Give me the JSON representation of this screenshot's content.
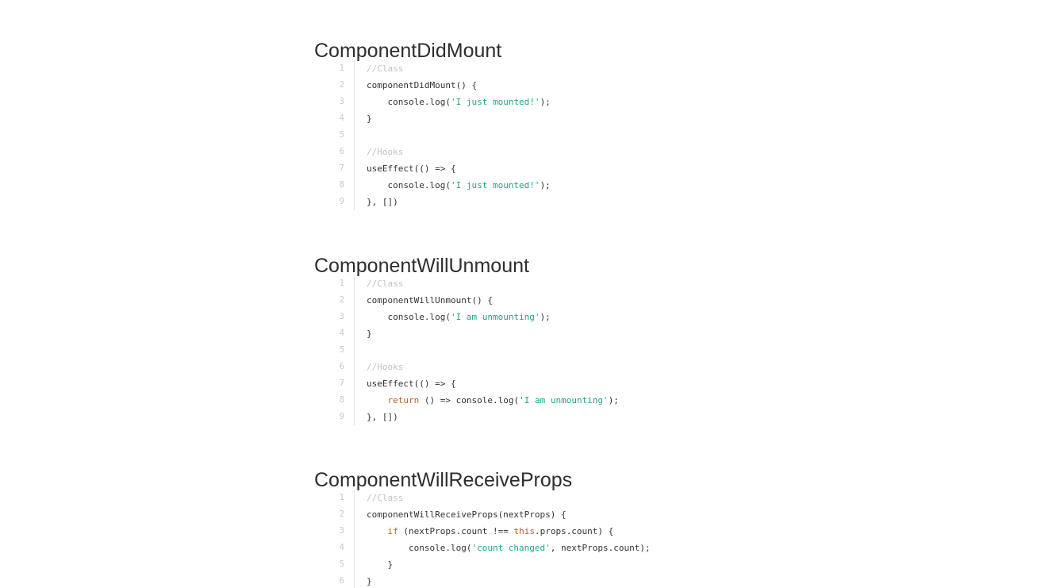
{
  "colors": {
    "comment": "#c2c2c2",
    "string": "#22a38a",
    "keyword": "#b5651d",
    "plain": "#333333",
    "line_number": "#c8c8c8"
  },
  "sections": [
    {
      "title": "ComponentDidMount",
      "lines": [
        {
          "n": "1",
          "tokens": [
            {
              "t": "comment",
              "v": "//Class"
            }
          ]
        },
        {
          "n": "2",
          "tokens": [
            {
              "t": "plain",
              "v": "componentDidMount() {"
            }
          ]
        },
        {
          "n": "3",
          "tokens": [
            {
              "t": "plain",
              "v": "    console.log("
            },
            {
              "t": "string",
              "v": "'I just mounted!'"
            },
            {
              "t": "plain",
              "v": ");"
            }
          ]
        },
        {
          "n": "4",
          "tokens": [
            {
              "t": "plain",
              "v": "}"
            }
          ]
        },
        {
          "n": "5",
          "tokens": []
        },
        {
          "n": "6",
          "tokens": [
            {
              "t": "comment",
              "v": "//Hooks"
            }
          ]
        },
        {
          "n": "7",
          "tokens": [
            {
              "t": "plain",
              "v": "useEffect(() => {"
            }
          ]
        },
        {
          "n": "8",
          "tokens": [
            {
              "t": "plain",
              "v": "    console.log("
            },
            {
              "t": "string",
              "v": "'I just mounted!'"
            },
            {
              "t": "plain",
              "v": ");"
            }
          ]
        },
        {
          "n": "9",
          "tokens": [
            {
              "t": "plain",
              "v": "}, [])"
            }
          ]
        }
      ]
    },
    {
      "title": "ComponentWillUnmount",
      "lines": [
        {
          "n": "1",
          "tokens": [
            {
              "t": "comment",
              "v": "//Class"
            }
          ]
        },
        {
          "n": "2",
          "tokens": [
            {
              "t": "plain",
              "v": "componentWillUnmount() {"
            }
          ]
        },
        {
          "n": "3",
          "tokens": [
            {
              "t": "plain",
              "v": "    console.log("
            },
            {
              "t": "string",
              "v": "'I am unmounting'"
            },
            {
              "t": "plain",
              "v": ");"
            }
          ]
        },
        {
          "n": "4",
          "tokens": [
            {
              "t": "plain",
              "v": "}"
            }
          ]
        },
        {
          "n": "5",
          "tokens": []
        },
        {
          "n": "6",
          "tokens": [
            {
              "t": "comment",
              "v": "//Hooks"
            }
          ]
        },
        {
          "n": "7",
          "tokens": [
            {
              "t": "plain",
              "v": "useEffect(() => {"
            }
          ]
        },
        {
          "n": "8",
          "tokens": [
            {
              "t": "plain",
              "v": "    "
            },
            {
              "t": "keyword",
              "v": "return"
            },
            {
              "t": "plain",
              "v": " () => console.log("
            },
            {
              "t": "string",
              "v": "'I am unmounting'"
            },
            {
              "t": "plain",
              "v": ");"
            }
          ]
        },
        {
          "n": "9",
          "tokens": [
            {
              "t": "plain",
              "v": "}, [])"
            }
          ]
        }
      ]
    },
    {
      "title": "ComponentWillReceiveProps",
      "lines": [
        {
          "n": "1",
          "tokens": [
            {
              "t": "comment",
              "v": "//Class"
            }
          ]
        },
        {
          "n": "2",
          "tokens": [
            {
              "t": "plain",
              "v": "componentWillReceiveProps(nextProps) {"
            }
          ]
        },
        {
          "n": "3",
          "tokens": [
            {
              "t": "plain",
              "v": "    "
            },
            {
              "t": "keyword",
              "v": "if"
            },
            {
              "t": "plain",
              "v": " (nextProps.count !== "
            },
            {
              "t": "keyword",
              "v": "this"
            },
            {
              "t": "plain",
              "v": ".props.count) {"
            }
          ]
        },
        {
          "n": "4",
          "tokens": [
            {
              "t": "plain",
              "v": "        console.log("
            },
            {
              "t": "string",
              "v": "'count changed'"
            },
            {
              "t": "plain",
              "v": ", nextProps.count);"
            }
          ]
        },
        {
          "n": "5",
          "tokens": [
            {
              "t": "plain",
              "v": "    }"
            }
          ]
        },
        {
          "n": "6",
          "tokens": [
            {
              "t": "plain",
              "v": "}"
            }
          ]
        }
      ]
    }
  ]
}
